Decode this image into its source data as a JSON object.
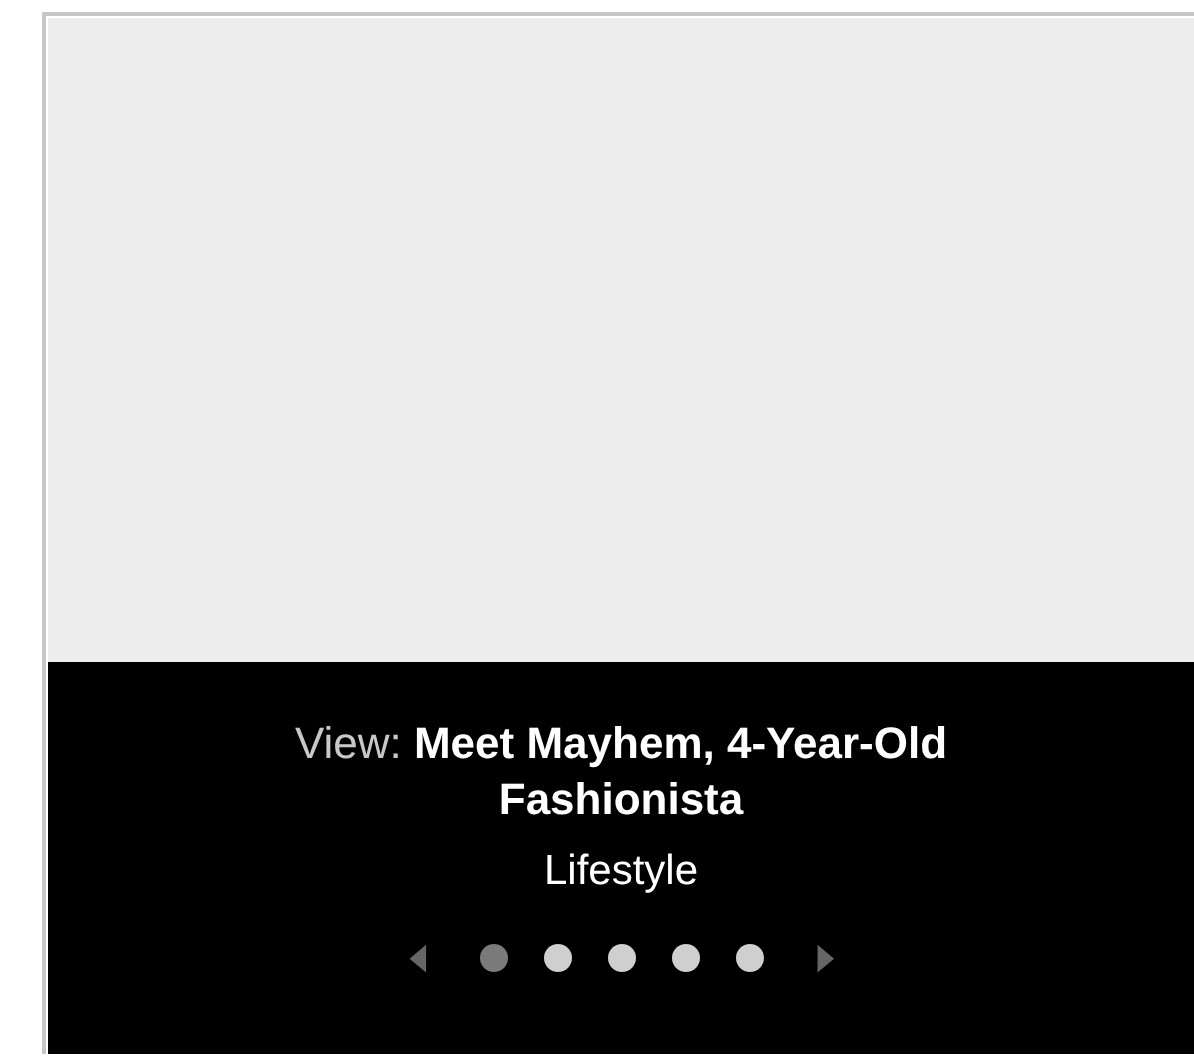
{
  "caption": {
    "title": "View: **Meet Mayhem, 4-Year-Old Fashionista**",
    "category": "Lifestyle"
  },
  "pager": {
    "prev": "◀",
    "next": "▶",
    "dots": [
      {
        "selected": true
      },
      {
        "selected": false
      },
      {
        "selected": false
      },
      {
        "selected": false
      },
      {
        "selected": false
      }
    ]
  }
}
